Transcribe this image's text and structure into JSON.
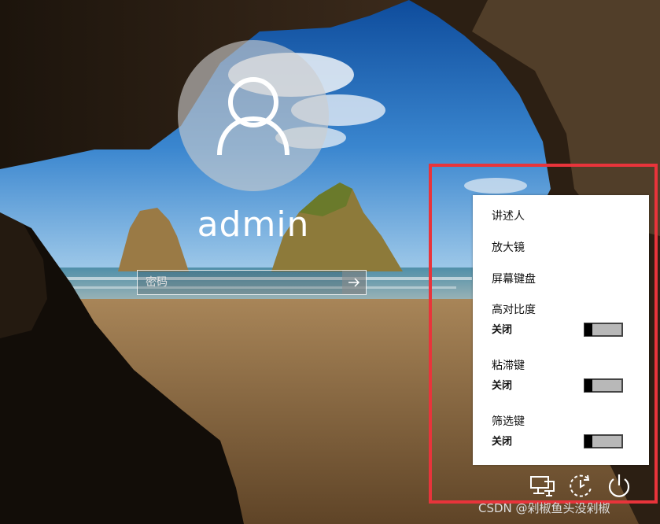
{
  "login": {
    "username": "admin",
    "password_placeholder": "密码"
  },
  "ease_menu": {
    "items": [
      "讲述人",
      "放大镜",
      "屏幕键盘"
    ],
    "toggles": [
      {
        "label": "高对比度",
        "state": "关闭",
        "on": false
      },
      {
        "label": "粘滞键",
        "state": "关闭",
        "on": false
      },
      {
        "label": "筛选键",
        "state": "关闭",
        "on": false
      }
    ]
  },
  "bottom_bar": {
    "icons": [
      "network-icon",
      "ease-of-access-icon",
      "power-icon"
    ]
  },
  "watermark": "CSDN @剁椒鱼头没剁椒",
  "colors": {
    "highlight_border": "#e8343b",
    "menu_background": "#ffffff"
  }
}
